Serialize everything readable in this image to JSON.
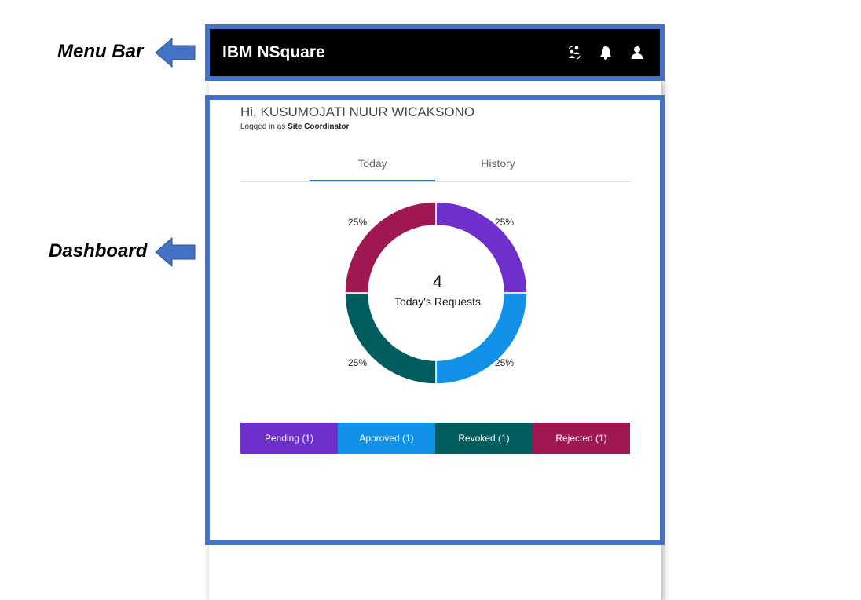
{
  "annotations": {
    "menu_bar": "Menu Bar",
    "dashboard": "Dashboard"
  },
  "menubar": {
    "brand": "IBM NSquare",
    "icons": [
      "people-swap-icon",
      "bell-icon",
      "user-icon"
    ]
  },
  "dashboard": {
    "greeting": "Hi, KUSUMOJATI NUUR WICAKSONO",
    "logged_in_prefix": "Logged in as",
    "role": "Site Coordinator",
    "tabs": [
      {
        "label": "Today",
        "active": true
      },
      {
        "label": "History",
        "active": false
      }
    ],
    "center_count": "4",
    "center_label": "Today's Requests",
    "legend": [
      {
        "label": "Pending (1)",
        "color": "#6f2fcc"
      },
      {
        "label": "Approved (1)",
        "color": "#1192e8"
      },
      {
        "label": "Revoked (1)",
        "color": "#005d5d"
      },
      {
        "label": "Rejected (1)",
        "color": "#9f1853"
      }
    ]
  },
  "chart_data": {
    "type": "pie",
    "categories": [
      "Pending",
      "Approved",
      "Revoked",
      "Rejected"
    ],
    "values": [
      1,
      1,
      1,
      1
    ],
    "labels": [
      "25%",
      "25%",
      "25%",
      "25%"
    ],
    "colors": [
      "#6f2fcc",
      "#1192e8",
      "#005d5d",
      "#9f1853"
    ]
  },
  "colors": {
    "annotation_frame": "#4472c4",
    "tab_active": "#1f6fd1"
  }
}
